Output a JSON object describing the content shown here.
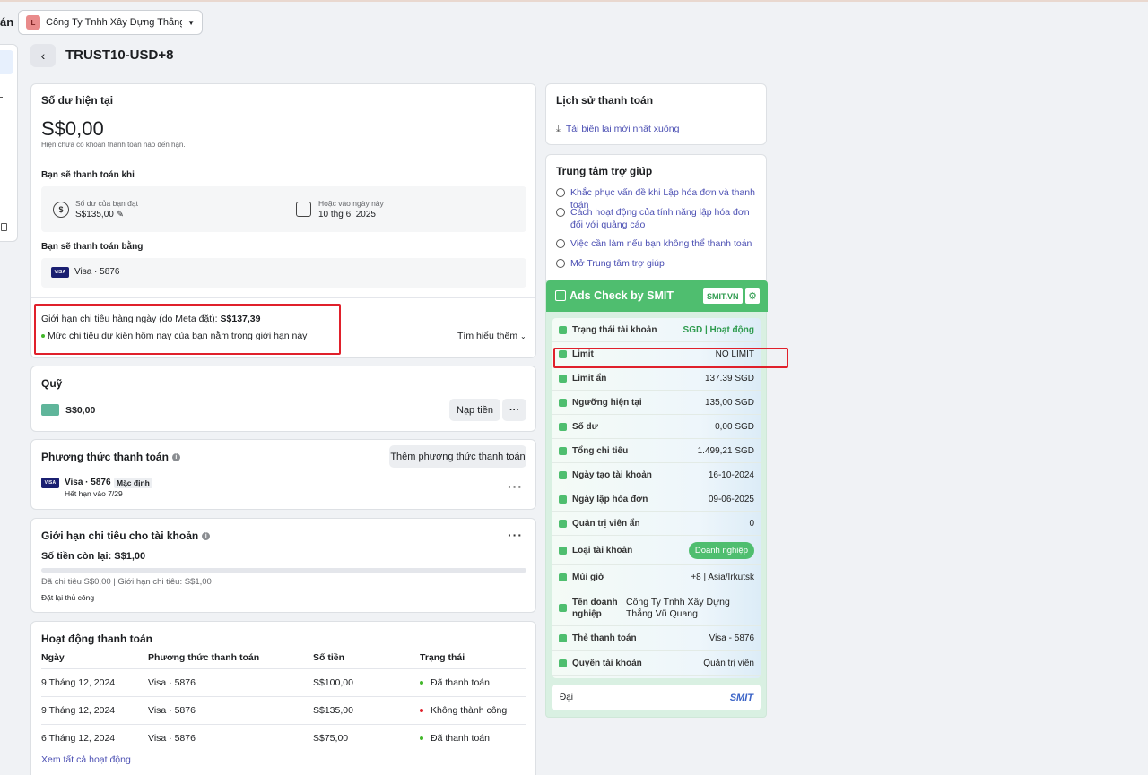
{
  "header": {
    "left_fragment": "án",
    "company_avatar": "L",
    "company_name": "Công Ty Tnhh Xây Dựng Thắng V...",
    "account_title": "TRUST10-USD+8"
  },
  "balance": {
    "title": "Số dư hiện tại",
    "amount": "S$0,00",
    "subtitle": "Hiện chưa có khoản thanh toán nào đến hạn.",
    "pay_when_title": "Bạn sẽ thanh toán khi",
    "threshold_label": "Số dư của bạn đạt",
    "threshold_value": "S$135,00",
    "date_label": "Hoặc vào ngày này",
    "date_value": "10 thg 6, 2025",
    "pay_with_title": "Bạn sẽ thanh toán bằng",
    "card_brand": "VISA",
    "card_text": "Visa · 5876",
    "daily_limit_label": "Giới hạn chi tiêu hàng ngày (do Meta đặt):",
    "daily_limit_value": "S$137,39",
    "daily_limit_note": "Mức chi tiêu dự kiến hôm nay của bạn nằm trong giới hạn này",
    "learn_more": "Tìm hiểu thêm"
  },
  "funds": {
    "title": "Quỹ",
    "amount": "S$0,00",
    "add_button": "Nạp tiền",
    "more": "···"
  },
  "payment_methods": {
    "title": "Phương thức thanh toán",
    "add_button": "Thêm phương thức thanh toán",
    "card_brand": "VISA",
    "card_name": "Visa · 5876",
    "default_badge": "Mặc định",
    "expiry": "Hết hạn vào 7/29",
    "more": "···"
  },
  "spend_limit": {
    "title": "Giới hạn chi tiêu cho tài khoản",
    "remaining": "Số tiền còn lại: S$1,00",
    "detail": "Đã chi tiêu S$0,00 | Giới hạn chi tiêu: S$1,00",
    "reset": "Đặt lại thủ công",
    "more": "···",
    "progress": 0
  },
  "activity": {
    "title": "Hoạt động thanh toán",
    "columns": [
      "Ngày",
      "Phương thức thanh toán",
      "Số tiền",
      "Trạng thái"
    ],
    "rows": [
      {
        "date": "9 Tháng 12, 2024",
        "method": "Visa · 5876",
        "amount": "S$100,00",
        "status": "Đã thanh toán",
        "color": "#42b72a"
      },
      {
        "date": "9 Tháng 12, 2024",
        "method": "Visa · 5876",
        "amount": "S$135,00",
        "status": "Không thành công",
        "color": "#e0202b"
      },
      {
        "date": "6 Tháng 12, 2024",
        "method": "Visa · 5876",
        "amount": "S$75,00",
        "status": "Đã thanh toán",
        "color": "#42b72a"
      }
    ],
    "see_all": "Xem tất cả hoạt động"
  },
  "history": {
    "title": "Lịch sử thanh toán",
    "download": "Tải biên lai mới nhất xuống"
  },
  "help": {
    "title": "Trung tâm trợ giúp",
    "items": [
      "Khắc phục vấn đề khi Lập hóa đơn và thanh toán",
      "Cách hoạt động của tính năng lập hóa đơn đối với quảng cáo",
      "Việc cần làm nếu bạn không thể thanh toán",
      "Mở Trung tâm trợ giúp"
    ]
  },
  "smit": {
    "title": "Ads Check by SMIT",
    "badge": "SMIT.VN",
    "rows": [
      {
        "label": "Trạng thái tài khoản",
        "value": "SGD | Hoạt động"
      },
      {
        "label": "Limit",
        "value": "NO LIMIT"
      },
      {
        "label": "Limit ẩn",
        "value": "137.39 SGD"
      },
      {
        "label": "Ngưỡng hiện tại",
        "value": "135,00 SGD"
      },
      {
        "label": "Số dư",
        "value": "0,00 SGD"
      },
      {
        "label": "Tổng chi tiêu",
        "value": "1.499,21 SGD"
      },
      {
        "label": "Ngày tạo tài khoản",
        "value": "16-10-2024"
      },
      {
        "label": "Ngày lập hóa đơn",
        "value": "09-06-2025"
      },
      {
        "label": "Quản trị viên ẩn",
        "value": "0"
      },
      {
        "label": "Loại tài khoản",
        "value": "Doanh nghiệp"
      },
      {
        "label": "Múi giờ",
        "value": "+8 | Asia/Irkutsk"
      },
      {
        "label": "Tên doanh nghiệp",
        "value": "Công Ty Tnhh Xây Dựng Thắng Vũ Quang"
      },
      {
        "label": "Thẻ thanh toán",
        "value": "Visa - 5876"
      },
      {
        "label": "Quyền tài khoản",
        "value": "Quản trị viên"
      }
    ],
    "footer_left": "Đại",
    "footer_brand": "SMIT"
  }
}
